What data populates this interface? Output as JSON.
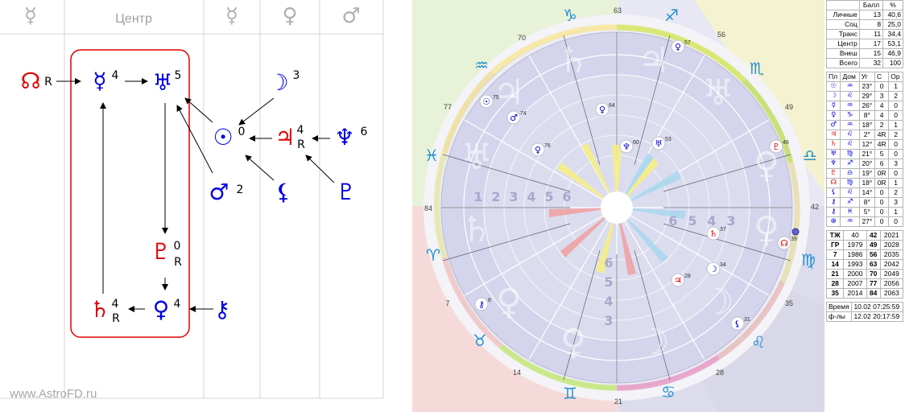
{
  "left_panel": {
    "header_left_symbol": "☿",
    "header_center": "Центр",
    "header_symbols": [
      "☿",
      "♀",
      "♂"
    ],
    "watermark": "www.AstroFD.ru",
    "nodes": {
      "node": {
        "glyph": "☊",
        "label": "R"
      },
      "mercury": {
        "glyph": "☿",
        "label": "4"
      },
      "uranus": {
        "glyph": "♅",
        "label": "5"
      },
      "moon": {
        "glyph": "☽",
        "label": "3"
      },
      "sun": {
        "glyph": "☉",
        "label": "0"
      },
      "jupiter": {
        "glyph": "♃",
        "label": "4",
        "label2": "R"
      },
      "neptune": {
        "glyph": "♆",
        "label": "6"
      },
      "mars": {
        "glyph": "♂",
        "label": "2"
      },
      "lilith": {
        "glyph": "⚸",
        "label": ""
      },
      "proserpina": {
        "glyph": "♇",
        "label": ""
      },
      "pluto": {
        "glyph": "♇",
        "label": "0",
        "label2": "R"
      },
      "saturn": {
        "glyph": "♄",
        "label": "4",
        "label2": "R"
      },
      "venus": {
        "glyph": "♀",
        "label": "4"
      },
      "chiron": {
        "glyph": "⚷",
        "label": ""
      }
    }
  },
  "chart": {
    "degree_marks": [
      "63",
      "56",
      "49",
      "42",
      "35",
      "28",
      "21",
      "14",
      "7",
      "84",
      "77",
      "70"
    ],
    "signs": [
      "♑",
      "♐",
      "♏",
      "♎",
      "♍",
      "♌",
      "♋",
      "♊",
      "♉",
      "♈",
      "♓",
      "♒"
    ],
    "planets": [
      {
        "glyph": "♀",
        "num": "57"
      },
      {
        "glyph": "♀",
        "num": "64"
      },
      {
        "glyph": "☉",
        "num": "75"
      },
      {
        "glyph": "♂",
        "num": "74"
      },
      {
        "glyph": "♀",
        "num": "76"
      },
      {
        "glyph": "♆",
        "num": "60"
      },
      {
        "glyph": "♅",
        "num": "53"
      },
      {
        "glyph": "♇",
        "num": "46"
      },
      {
        "glyph": "☊",
        "num": "39"
      },
      {
        "glyph": "♄",
        "num": "37"
      },
      {
        "glyph": "☽",
        "num": "34"
      },
      {
        "glyph": "♃",
        "num": "28"
      },
      {
        "glyph": "⚸",
        "num": "31"
      },
      {
        "glyph": "⚷",
        "num": "8"
      }
    ],
    "house_numbers_left": [
      "1",
      "2",
      "3",
      "4",
      "5",
      "6"
    ],
    "house_numbers_right": [
      "6",
      "5",
      "4",
      "3"
    ],
    "house_numbers_bottom": [
      "6",
      "5",
      "4",
      "3"
    ]
  },
  "score_table": {
    "headers": [
      "",
      "Балл",
      "%"
    ],
    "rows": [
      [
        "Личные",
        "13",
        "40,6"
      ],
      [
        "Соц",
        "8",
        "25,0"
      ],
      [
        "Транс",
        "11",
        "34,4"
      ],
      [
        "Центр",
        "17",
        "53,1"
      ],
      [
        "Внеш",
        "15",
        "46,9"
      ],
      [
        "Всего",
        "32",
        "100"
      ]
    ]
  },
  "planet_table": {
    "headers": [
      "Пл",
      "Дом",
      "Уг",
      "С",
      "Ор"
    ],
    "rows": [
      [
        "☉",
        "♒",
        "23°",
        "0",
        "1"
      ],
      [
        "☽",
        "♌",
        "29°",
        "3",
        "2"
      ],
      [
        "☿",
        "♒",
        "26°",
        "4",
        "0"
      ],
      [
        "♀",
        "♑",
        "8°",
        "4",
        "0"
      ],
      [
        "♂",
        "♒",
        "18°",
        "2",
        "1"
      ],
      [
        "♃",
        "♌",
        "2°",
        "4R",
        "2"
      ],
      [
        "♄",
        "♌",
        "12°",
        "4R",
        "0"
      ],
      [
        "♅",
        "♍",
        "21°",
        "5",
        "0"
      ],
      [
        "♆",
        "♐",
        "20°",
        "6",
        "3"
      ],
      [
        "♇",
        "♎",
        "19°",
        "0R",
        "0"
      ],
      [
        "☊",
        "♍",
        "18°",
        "0R",
        "1"
      ],
      [
        "⚸",
        "♌",
        "14°",
        "0",
        "2"
      ],
      [
        "⚷",
        "♐",
        "8°",
        "0",
        "3"
      ],
      [
        "⚷",
        "♓",
        "5°",
        "0",
        "1"
      ],
      [
        "⊕",
        "♒",
        "27°",
        "0",
        "0"
      ]
    ]
  },
  "cycle_table": {
    "rows": [
      [
        "ТЖ",
        "40",
        "42",
        "2021"
      ],
      [
        "ГР",
        "1979",
        "49",
        "2028"
      ],
      [
        "7",
        "1986",
        "56",
        "2035"
      ],
      [
        "14",
        "1993",
        "63",
        "2042"
      ],
      [
        "21",
        "2000",
        "70",
        "2049"
      ],
      [
        "28",
        "2007",
        "77",
        "2056"
      ],
      [
        "35",
        "2014",
        "84",
        "2063"
      ]
    ]
  },
  "time_table": {
    "rows": [
      [
        "Время",
        "10.02 07:25:59"
      ],
      [
        "ф-лы",
        "12.02 20:17:59"
      ]
    ]
  }
}
